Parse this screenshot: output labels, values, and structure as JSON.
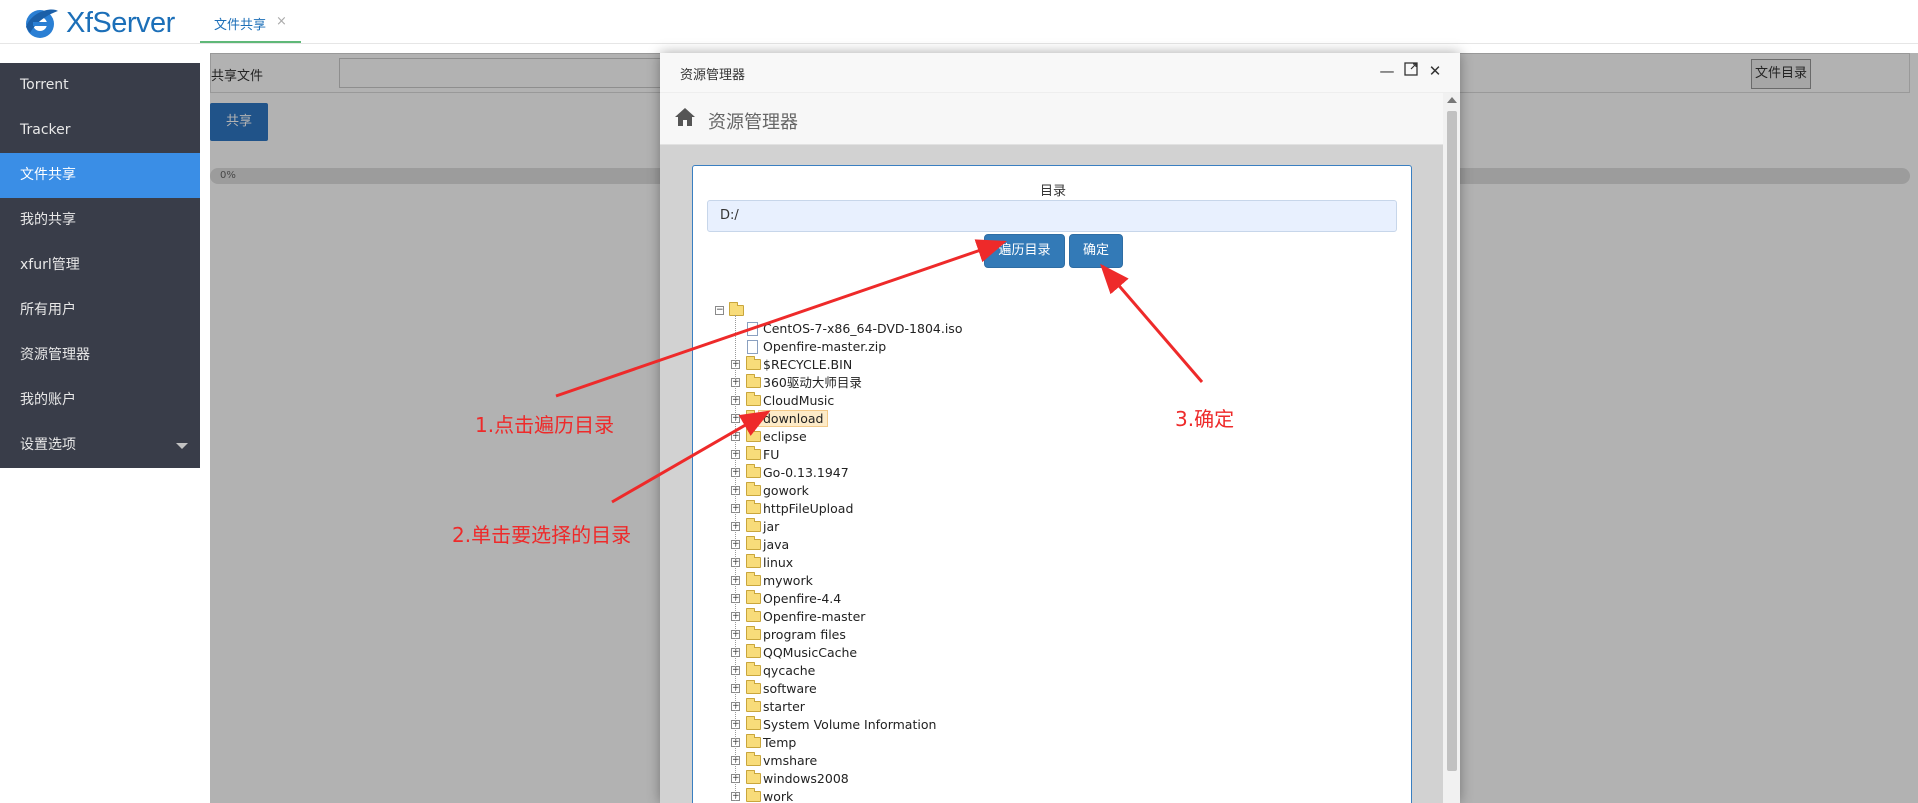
{
  "app": {
    "name": "XfServer"
  },
  "header_tab": {
    "label": "文件共享",
    "close": "×"
  },
  "sidebar": {
    "items": [
      {
        "label": "Torrent"
      },
      {
        "label": "Tracker"
      },
      {
        "label": "文件共享",
        "active": true
      },
      {
        "label": "我的共享"
      },
      {
        "label": "xfurl管理"
      },
      {
        "label": "所有用户"
      },
      {
        "label": "资源管理器"
      },
      {
        "label": "我的账户"
      },
      {
        "label": "设置选项"
      }
    ]
  },
  "main": {
    "share_file_label": "共享文件",
    "dir_button": "文件目录",
    "share_button": "共享",
    "progress_text": "0%"
  },
  "dialog": {
    "title": "资源管理器",
    "page_title": "资源管理器",
    "field_label": "目录",
    "directory_value": "D:/",
    "traverse_button": "遍历目录",
    "confirm_button": "确定",
    "files": [
      "CentOS-7-x86_64-DVD-1804.iso",
      "Openfire-master.zip"
    ],
    "folders": [
      "$RECYCLE.BIN",
      "360驱动大师目录",
      "CloudMusic",
      "download",
      "eclipse",
      "FU",
      "Go-0.13.1947",
      "gowork",
      "httpFileUpload",
      "jar",
      "java",
      "linux",
      "mywork",
      "Openfire-4.4",
      "Openfire-master",
      "program files",
      "QQMusicCache",
      "qycache",
      "software",
      "starter",
      "System Volume Information",
      "Temp",
      "vmshare",
      "windows2008",
      "work"
    ],
    "selected_folder": "download"
  },
  "annotations": {
    "step1": "1.点击遍历目录",
    "step2": "2.单击要选择的目录",
    "step3": "3.确定",
    "color": "#ee2a2a"
  },
  "colors": {
    "sidebar_bg": "#393d49",
    "sidebar_active": "#3a8ee6",
    "primary_button": "#337ab7",
    "logo_blue": "#1c6fb8"
  }
}
